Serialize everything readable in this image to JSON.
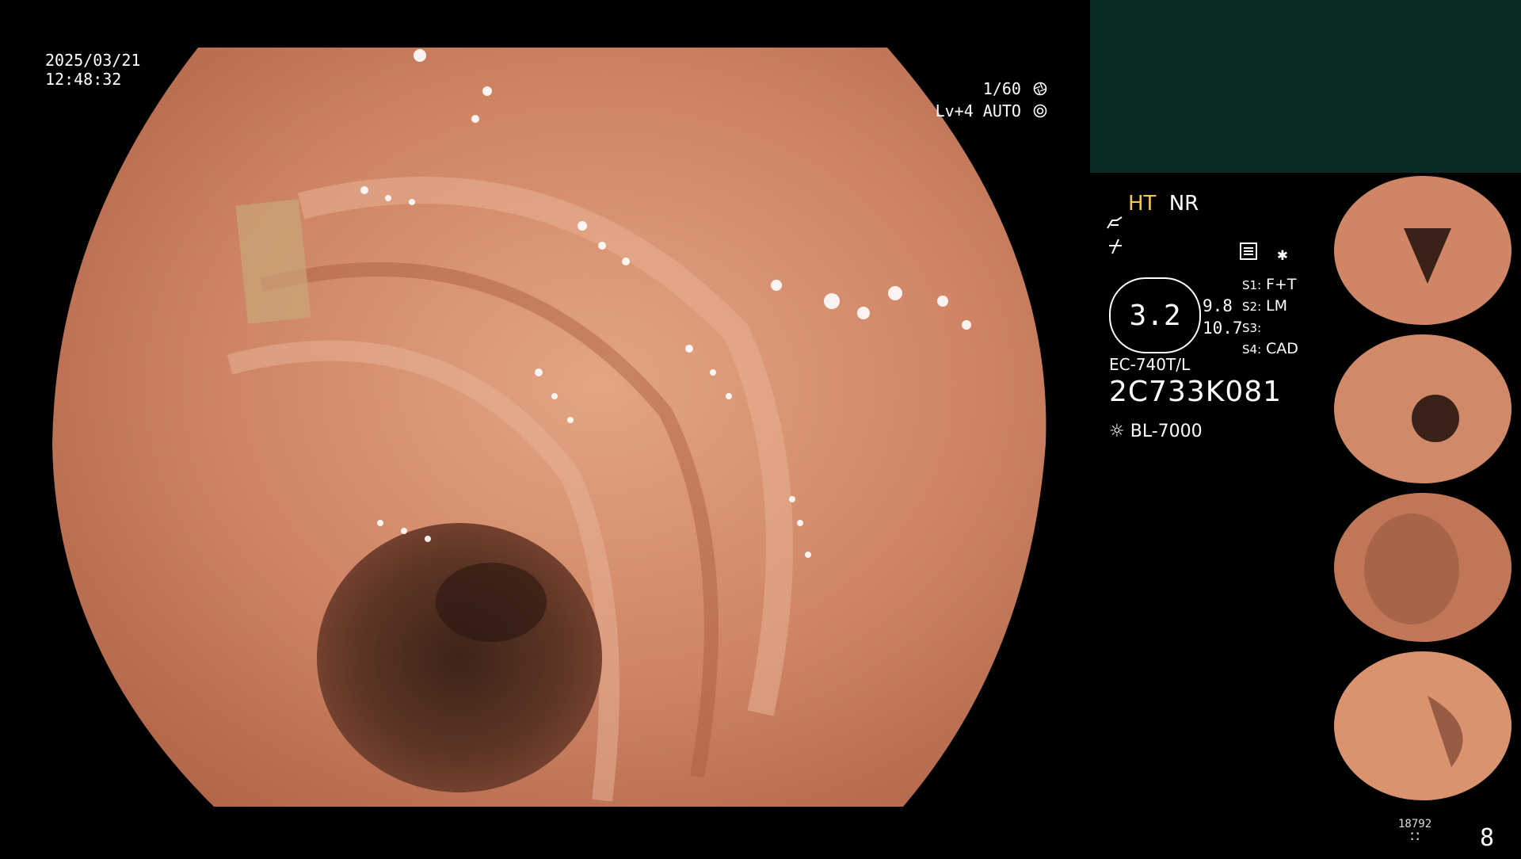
{
  "overlay": {
    "date": "2025/03/21",
    "time": "12:48:32",
    "shutter": "1/60",
    "shutter_icon": "aperture-icon",
    "level": "Lv+4 AUTO",
    "level_icon": "auto-iris-icon"
  },
  "info": {
    "ht": "HT",
    "nr": "NR",
    "ratio_value": "3.2",
    "side_top": "9.8",
    "side_bottom": "10.7",
    "scope_model": "EC-740T/L",
    "scope_serial": "2C733K081",
    "light_source": "BL-7000",
    "settings": [
      {
        "key": "S1:",
        "val": "F+T"
      },
      {
        "key": "S2:",
        "val": "LM"
      },
      {
        "key": "S3:",
        "val": ""
      },
      {
        "key": "S4:",
        "val": "CAD"
      }
    ]
  },
  "footer": {
    "counter": "18792",
    "page": "8"
  },
  "colors": {
    "accent_ht": "#f2c94c",
    "panel_teal": "#0b2c24",
    "tissue": "#c8785a"
  }
}
